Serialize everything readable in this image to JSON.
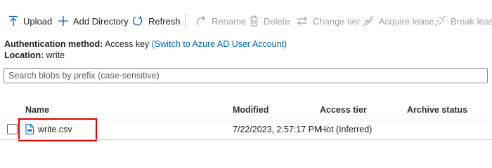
{
  "toolbar": {
    "upload": "Upload",
    "add_directory": "Add Directory",
    "refresh": "Refresh",
    "rename": "Rename",
    "delete": "Delete",
    "change_tier": "Change tier",
    "acquire_lease": "Acquire lease",
    "break_lease": "Break lease"
  },
  "info": {
    "auth_label": "Authentication method:",
    "auth_value": "Access key",
    "auth_link": "(Switch to Azure AD User Account)",
    "location_label": "Location:",
    "location_value": "write"
  },
  "search": {
    "placeholder": "Search blobs by prefix (case-sensitive)"
  },
  "table": {
    "columns": [
      "Name",
      "Modified",
      "Access tier",
      "Archive status"
    ],
    "rows": [
      {
        "name": "write.csv",
        "modified": "7/22/2023, 2:57:17 PM",
        "access_tier": "Hot (Inferred)",
        "archive_status": ""
      }
    ]
  },
  "colors": {
    "accent": "#0063b1",
    "highlight": "#e00000",
    "disabled": "#a19f9d"
  }
}
